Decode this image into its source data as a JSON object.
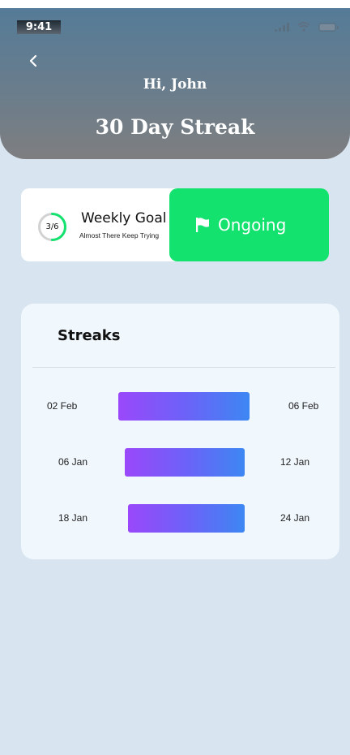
{
  "status_bar": {
    "time": "9:41"
  },
  "header": {
    "greeting": "Hi, John",
    "title": "30 Day Streak"
  },
  "weekly_goal": {
    "progress_label": "3/6",
    "progress_fraction": 0.5,
    "title": "Weekly Goal",
    "subtitle": "Almost There Keep Trying",
    "status_button": "Ongoing"
  },
  "streaks": {
    "title": "Streaks",
    "items": [
      {
        "start": "02 Feb",
        "end": "06 Feb"
      },
      {
        "start": "06 Jan",
        "end": "12 Jan"
      },
      {
        "start": "18 Jan",
        "end": "24 Jan"
      }
    ]
  },
  "colors": {
    "accent_green": "#13e26e",
    "bar_gradient_start": "#9a48fa",
    "bar_gradient_end": "#3d87f3",
    "background": "#d8e5f0"
  },
  "icons": {
    "back": "chevron-left-icon",
    "status": "flag-icon",
    "signal": "signal-icon",
    "wifi": "wifi-icon",
    "battery": "battery-icon"
  }
}
